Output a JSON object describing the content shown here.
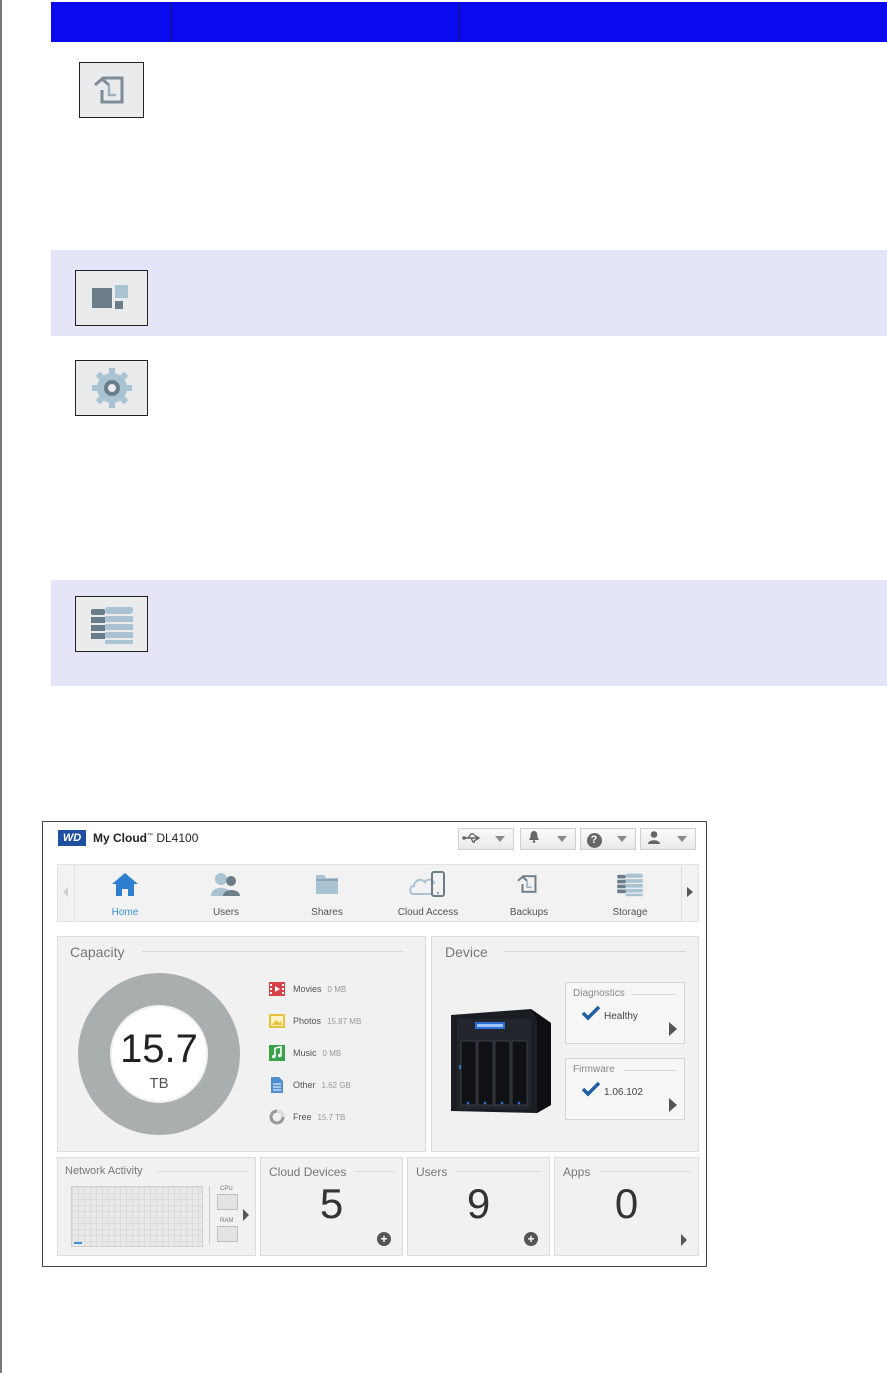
{
  "colors": {
    "table_header": "#0a0aee",
    "row_shade": "#e5e5fa",
    "accent": "#3a8fd8",
    "check": "#1f5fa0",
    "donut": "#a9aeae"
  },
  "doc_icons": [
    "backups-icon",
    "apps-icon",
    "settings-gear-icon",
    "storage-icon"
  ],
  "app": {
    "logo": "WD",
    "brand": "My Cloud",
    "trademark": "™",
    "model": "DL4100",
    "top_buttons": [
      "usb-icon",
      "bell-icon",
      "help-icon",
      "user-icon"
    ],
    "help_glyph": "?"
  },
  "nav": {
    "items": [
      {
        "label": "Home",
        "icon": "home-icon"
      },
      {
        "label": "Users",
        "icon": "users-icon"
      },
      {
        "label": "Shares",
        "icon": "shares-folder-icon"
      },
      {
        "label": "Cloud Access",
        "icon": "cloud-access-icon"
      },
      {
        "label": "Backups",
        "icon": "backups-icon"
      },
      {
        "label": "Storage",
        "icon": "storage-icon"
      }
    ],
    "active": "Home"
  },
  "capacity": {
    "title": "Capacity",
    "value": "15.7",
    "unit": "TB",
    "legend": [
      {
        "label": "Movies",
        "value": "0 MB",
        "icon": "movies-icon",
        "color": "#d9414a"
      },
      {
        "label": "Photos",
        "value": "15.87 MB",
        "icon": "photos-icon",
        "color": "#e8c23a"
      },
      {
        "label": "Music",
        "value": "0 MB",
        "icon": "music-icon",
        "color": "#3aa24a"
      },
      {
        "label": "Other",
        "value": "1.62 GB",
        "icon": "other-document-icon",
        "color": "#4f8fd0"
      },
      {
        "label": "Free",
        "value": "15.7 TB",
        "icon": "free-space-icon",
        "color": "#999999"
      }
    ]
  },
  "device": {
    "title": "Device",
    "diagnostics": {
      "title": "Diagnostics",
      "status": "Healthy"
    },
    "firmware": {
      "title": "Firmware",
      "version": "1.06.102"
    }
  },
  "network": {
    "title": "Network Activity",
    "cpu_label": "CPU",
    "ram_label": "RAM"
  },
  "cloud_devices": {
    "title": "Cloud Devices",
    "count": "5"
  },
  "users": {
    "title": "Users",
    "count": "9"
  },
  "apps": {
    "title": "Apps",
    "count": "0"
  }
}
